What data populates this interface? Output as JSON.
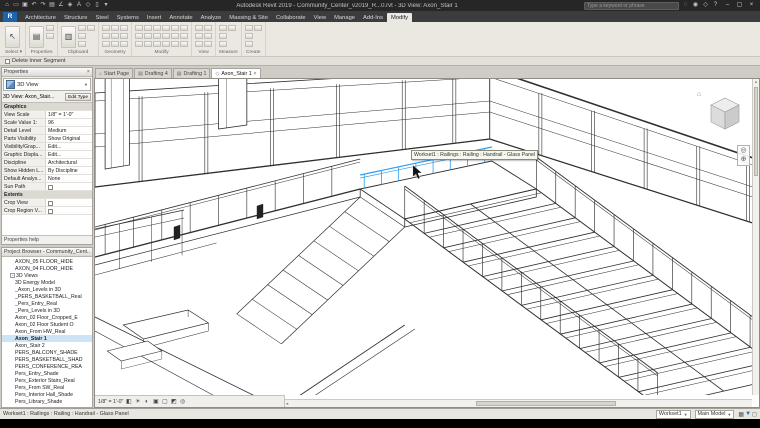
{
  "titlebar": {
    "qat": [
      {
        "name": "app-home-icon",
        "glyph": "⌂"
      },
      {
        "name": "open-icon",
        "glyph": "▭"
      },
      {
        "name": "save-icon",
        "glyph": "▣"
      },
      {
        "name": "undo-icon",
        "glyph": "↶"
      },
      {
        "name": "redo-icon",
        "glyph": "↷"
      },
      {
        "name": "print-icon",
        "glyph": "▤"
      },
      {
        "name": "measure-icon",
        "glyph": "∠"
      },
      {
        "name": "tag-icon",
        "glyph": "◈"
      },
      {
        "name": "text-icon",
        "glyph": "A"
      },
      {
        "name": "3d-view-icon",
        "glyph": "◇"
      },
      {
        "name": "section-icon",
        "glyph": "▯"
      },
      {
        "name": "qat-customize-icon",
        "glyph": "▾"
      }
    ],
    "title": "Autodesk Revit 2019 - Community_Center_v2019_R...0.rvt - 3D View: Axon_Stair 1",
    "search_placeholder": "Type a keyword or phrase",
    "right_icons": [
      {
        "name": "search-icon",
        "glyph": "◌"
      },
      {
        "name": "sign-in-icon",
        "glyph": "◉"
      },
      {
        "name": "exchange-apps-icon",
        "glyph": "◇"
      },
      {
        "name": "help-icon",
        "glyph": "?"
      }
    ],
    "window_buttons": [
      {
        "name": "minimize-button",
        "glyph": "–"
      },
      {
        "name": "restore-button",
        "glyph": "▢"
      },
      {
        "name": "close-button",
        "glyph": "×"
      }
    ]
  },
  "ribbon": {
    "file_button": "R",
    "tabs": [
      "Architecture",
      "Structure",
      "Steel",
      "Systems",
      "Insert",
      "Annotate",
      "Analyze",
      "Massing & Site",
      "Collaborate",
      "View",
      "Manage",
      "Add-Ins",
      "Modify"
    ],
    "active_tab": "Modify",
    "panels": [
      {
        "label": "Select ▾",
        "big": [
          {
            "name": "modify-tool-button",
            "glyph": "↖"
          }
        ]
      },
      {
        "label": "Properties",
        "big": [
          {
            "name": "properties-button",
            "glyph": "▤"
          }
        ],
        "tools": 2
      },
      {
        "label": "Clipboard",
        "big": [
          {
            "name": "paste-button",
            "glyph": "▥"
          }
        ],
        "tools": 4
      },
      {
        "label": "Geometry",
        "tools": 9
      },
      {
        "label": "Modify",
        "tools": 18
      },
      {
        "label": "View",
        "tools": 6
      },
      {
        "label": "Measure",
        "tools": 4
      },
      {
        "label": "Create",
        "tools": 4
      }
    ]
  },
  "options_bar": {
    "delete_inner_segment_label": "Delete Inner Segment"
  },
  "properties": {
    "header": "Properties",
    "type_selector": "3D View",
    "instance_label": "3D View: Axon_Stair...",
    "edit_type_label": "Edit Type",
    "rows": [
      {
        "section": "Graphics"
      },
      {
        "label": "View Scale",
        "value": "1/8\" = 1'-0\""
      },
      {
        "label": "Scale Value   1:",
        "value": "96"
      },
      {
        "label": "Detail Level",
        "value": "Medium"
      },
      {
        "label": "Parts Visibility",
        "value": "Show Original"
      },
      {
        "label": "Visibility/Grap...",
        "value": "Edit..."
      },
      {
        "label": "Graphic Displa...",
        "value": "Edit..."
      },
      {
        "label": "Discipline",
        "value": "Architectural"
      },
      {
        "label": "Show Hidden L...",
        "value": "By Discipline"
      },
      {
        "label": "Default Analys...",
        "value": "None"
      },
      {
        "label": "Sun Path",
        "checkbox": true
      },
      {
        "section": "Extents"
      },
      {
        "label": "Crop View",
        "checkbox": true
      },
      {
        "label": "Crop Region V...",
        "checkbox": true
      }
    ],
    "help_label": "Properties help"
  },
  "project_browser": {
    "header": "Project Browser - Community_Cent...",
    "items": [
      {
        "label": "AXON_05 FLOOR_HIDE",
        "indent": 2
      },
      {
        "label": "AXON_04 FLOOR_HIDE",
        "indent": 2
      },
      {
        "label": "3D Views",
        "indent": 1,
        "expandable": true
      },
      {
        "label": "3D Energy Model",
        "indent": 2
      },
      {
        "label": "_Axon_Levels in 3D",
        "indent": 2
      },
      {
        "label": "_PERS_BASKETBALL_Real",
        "indent": 2
      },
      {
        "label": "_Pers_Entry_Real",
        "indent": 2
      },
      {
        "label": "_Pers_Levels in 3D",
        "indent": 2
      },
      {
        "label": "Axon_02 Floor_Cropped_E",
        "indent": 2
      },
      {
        "label": "Axon_02 Floor Student O",
        "indent": 2
      },
      {
        "label": "Axon_From HW_Real",
        "indent": 2
      },
      {
        "label": "Axon_Stair 1",
        "indent": 2,
        "selected": true
      },
      {
        "label": "Axon_Stair 2",
        "indent": 2
      },
      {
        "label": "PERS_BALCONY_SHADE",
        "indent": 2
      },
      {
        "label": "PERS_BASKETBALL_SHAD",
        "indent": 2
      },
      {
        "label": "PERS_CONFERENCE_REA",
        "indent": 2
      },
      {
        "label": "Pers_Entry_Shade",
        "indent": 2
      },
      {
        "label": "Pers_Exterior Stairs_Real",
        "indent": 2
      },
      {
        "label": "Pers_From SW_Real",
        "indent": 2
      },
      {
        "label": "Pers_Interior Hall_Shade",
        "indent": 2
      },
      {
        "label": "Pers_Library_Shade",
        "indent": 2
      }
    ]
  },
  "view_tabs": {
    "tabs": [
      {
        "label": "Start Page",
        "icon": "home",
        "glyph": "⌂"
      },
      {
        "label": "Drafting 4",
        "icon": "sheet",
        "glyph": "▤"
      },
      {
        "label": "Drafting 1",
        "icon": "sheet",
        "glyph": "▤"
      },
      {
        "label": "Axon_Stair 1",
        "icon": "3d-view",
        "glyph": "◇",
        "active": true,
        "close": true
      }
    ]
  },
  "viewport": {
    "tooltip": "Workset1 : Railings : Railing : Handrail - Glass Panel",
    "scale_label": "1/8\" = 1'-0\"",
    "view_control_icons": [
      {
        "name": "visual-style-icon",
        "glyph": "◧"
      },
      {
        "name": "sun-path-icon",
        "glyph": "☀"
      },
      {
        "name": "shadows-icon",
        "glyph": "◐"
      },
      {
        "name": "crop-view-icon",
        "glyph": "▣"
      },
      {
        "name": "show-crop-icon",
        "glyph": "▢"
      },
      {
        "name": "temporary-hide-icon",
        "glyph": "◩"
      },
      {
        "name": "reveal-hidden-icon",
        "glyph": "◎"
      }
    ]
  },
  "statusbar": {
    "left_text": "Workset1 : Railings : Railing : Handrail - Glass Panel",
    "workset_label": "Workset1",
    "design_option_label": "Main Model",
    "right_icons": [
      {
        "name": "editable-only-icon",
        "glyph": "▦",
        "color": "#555555"
      },
      {
        "name": "filter-icon",
        "glyph": "▼",
        "color": "#1d6fb8"
      },
      {
        "name": "select-toggle-icon",
        "glyph": "◻",
        "color": "#555555"
      }
    ]
  }
}
